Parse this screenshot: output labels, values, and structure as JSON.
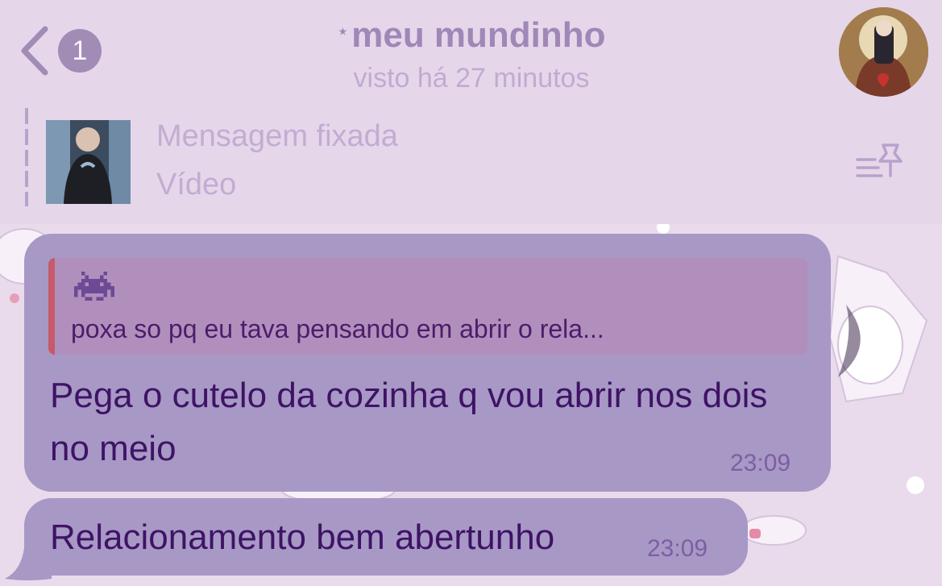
{
  "header": {
    "back_badge": "1",
    "title_prefix": "⋆",
    "title": "meu mundinho",
    "subtitle": "visto há 27 minutos"
  },
  "pinned": {
    "title": "Mensagem fixada",
    "subtitle": "Vídeo"
  },
  "messages": [
    {
      "reply_preview": "poxa so pq eu tava pensando em abrir o rela...",
      "reply_icon": "space-invader-icon",
      "text": "Pega o cutelo da cozinha q vou abrir nos dois no meio",
      "time": "23:09"
    },
    {
      "text": "Relacionamento bem abertunho",
      "time": "23:09"
    }
  ],
  "colors": {
    "background": "#e6d6ea",
    "bubble": "#a898c5",
    "reply_block": "#b18fbc",
    "reply_accent": "#c55a6a",
    "message_text": "#3e1366",
    "header_title": "#9f88b7"
  }
}
